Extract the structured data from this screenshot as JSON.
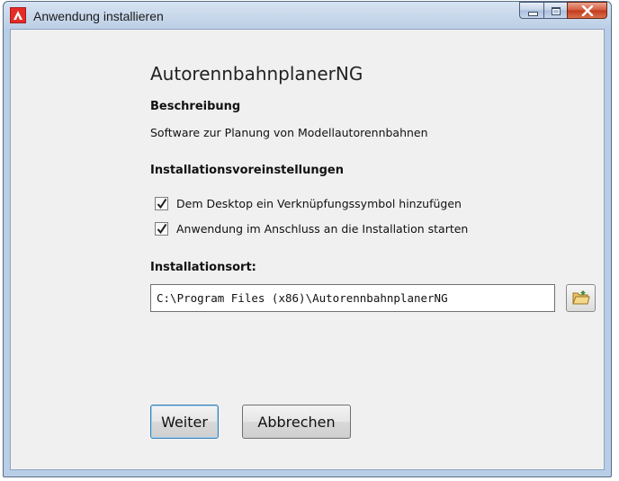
{
  "window": {
    "title": "Anwendung installieren",
    "icon": "adobe-air-icon",
    "caption_buttons": [
      "minimize-icon",
      "maximize-icon",
      "close-icon"
    ]
  },
  "app": {
    "name": "AutorennbahnplanerNG"
  },
  "description": {
    "heading": "Beschreibung",
    "text": "Software zur Planung von Modellautorennbahnen"
  },
  "preferences": {
    "heading": "Installationsvoreinstellungen",
    "options": [
      {
        "label": "Dem Desktop ein Verknüpfungssymbol hinzufügen",
        "checked": true
      },
      {
        "label": "Anwendung im Anschluss an die Installation starten",
        "checked": true
      }
    ]
  },
  "location": {
    "heading": "Installationsort:",
    "path": "C:\\Program Files (x86)\\AutorennbahnplanerNG",
    "browse_icon": "folder-icon"
  },
  "buttons": {
    "continue_label": "Weiter",
    "cancel_label": "Abbrechen"
  },
  "colors": {
    "accent_border": "#3c7fb1",
    "icon_red": "#e52c26"
  }
}
